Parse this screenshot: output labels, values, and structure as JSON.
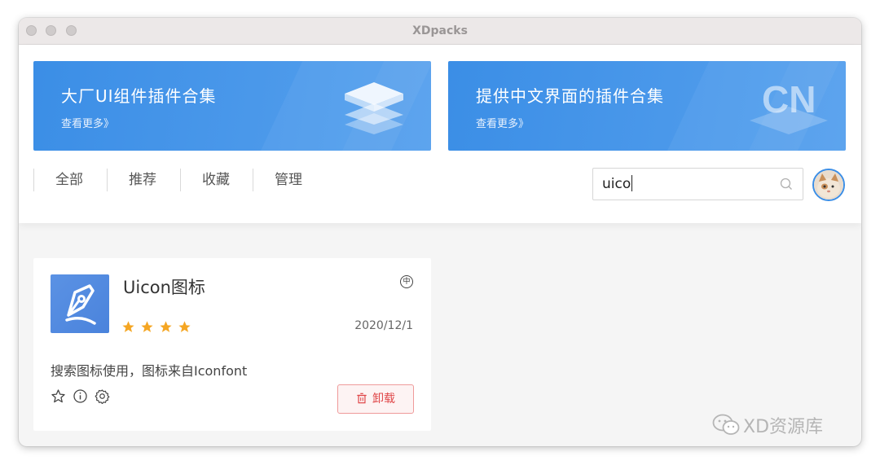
{
  "window": {
    "title": "XDpacks"
  },
  "banners": [
    {
      "title": "大厂UI组件插件合集",
      "more": "查看更多》",
      "badge_icon": "layers-stack-icon"
    },
    {
      "title": "提供中文界面的插件合集",
      "more": "查看更多》",
      "badge_text": "CN"
    }
  ],
  "tabs": [
    "全部",
    "推荐",
    "收藏",
    "管理"
  ],
  "search": {
    "value": "uico",
    "icon": "search-icon"
  },
  "plugin": {
    "name": "Uicon图标",
    "lang_badge": "中",
    "rating": 4,
    "date": "2020/12/1",
    "description": "搜索图标使用，图标来自Iconfont",
    "uninstall_label": "卸载"
  },
  "watermark": "XD资源库",
  "colors": {
    "accent": "#3b8ee6",
    "danger": "#e0484a",
    "star": "#f5a623"
  }
}
